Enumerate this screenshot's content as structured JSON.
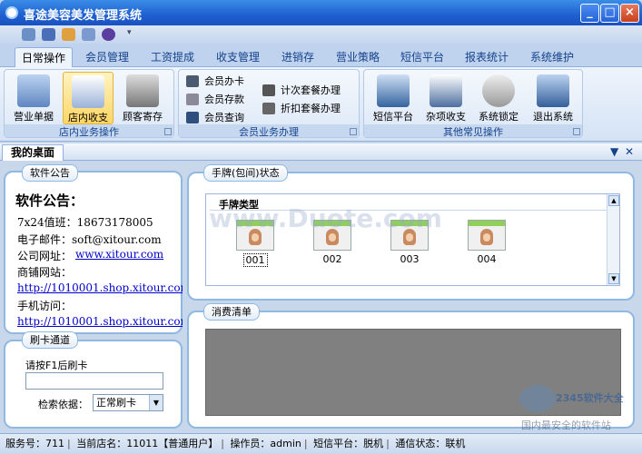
{
  "window": {
    "title": "喜途美容美发管理系统",
    "min": "_",
    "max": "□",
    "close": "×"
  },
  "ribbon": {
    "tabs": [
      "日常操作",
      "会员管理",
      "工资提成",
      "收支管理",
      "进销存",
      "营业策略",
      "短信平台",
      "报表统计",
      "系统维护"
    ],
    "groups": {
      "store": {
        "title": "店内业务操作",
        "buttons": [
          "营业单据",
          "店内收支",
          "顾客寄存"
        ]
      },
      "member": {
        "title": "会员业务办理",
        "buttons": [
          "会员办卡",
          "会员存款",
          "会员查询",
          "计次套餐办理",
          "折扣套餐办理"
        ]
      },
      "other": {
        "title": "其他常见操作",
        "buttons": [
          "短信平台",
          "杂项收支",
          "系统锁定",
          "退出系统"
        ]
      }
    }
  },
  "desktop": {
    "tab": "我的桌面",
    "dropdown": "▼",
    "close": "✕"
  },
  "announce": {
    "caption": "软件公告",
    "heading": "软件公告：",
    "lines": [
      "7x24值班：18673178005",
      "电子邮件：soft@xitour.com",
      "公司网址：",
      "www.xitour.com",
      "商铺网站：",
      "http://1010001.shop.xitour.com/",
      "手机访问：",
      "http://1010001.shop.xitour.com/m"
    ]
  },
  "card_channel": {
    "caption": "刷卡通道",
    "prompt": "请按F1后刷卡",
    "input_value": "",
    "search_label": "检索依据：",
    "search_value": "正常刷卡"
  },
  "hand_status": {
    "caption": "手牌(包间)状态",
    "type_header": "手牌类型",
    "cards": [
      "001",
      "002",
      "003",
      "004"
    ]
  },
  "consume": {
    "caption": "消费清单"
  },
  "watermarks": {
    "center": "www.Duote.com",
    "corner1": "2345软件大全",
    "corner2": "国内最安全的软件站"
  },
  "statusbar": {
    "service_no": "服务号：711",
    "shop": "当前店名：11011【普通用户】",
    "operator": "操作员：admin",
    "sms": "短信平台：脱机",
    "comm": "通信状态：联机"
  }
}
